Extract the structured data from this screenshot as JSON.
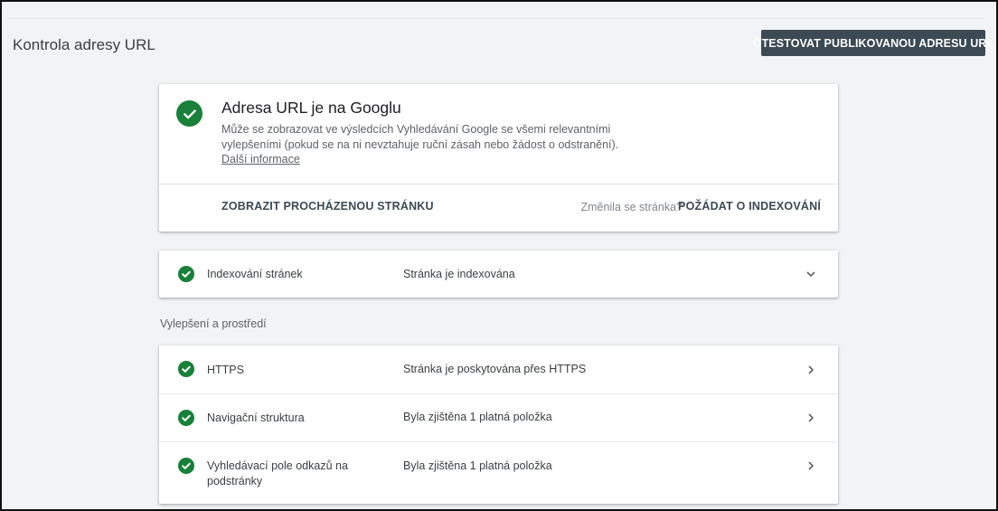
{
  "header": {
    "title": "Kontrola adresy URL",
    "test_live_label": "OTESTOVAT PUBLIKOVANOU ADRESU URL"
  },
  "status": {
    "heading": "Adresa URL je na Googlu",
    "description": "Může se zobrazovat ve výsledcích Vyhledávání Google se všemi relevantními vylepšeními (pokud se na ni nevztahuje ruční zásah nebo žádost o odstranění).",
    "learn_more": "Další informace",
    "view_crawled": "ZOBRAZIT PROCHÁZENOU STRÁNKU",
    "page_changed": "Změnila se stránka?",
    "request_indexing": "POŽÁDAT O INDEXOVÁNÍ"
  },
  "indexing": {
    "label": "Indexování stránek",
    "value": "Stránka je indexována"
  },
  "enhancements": {
    "section_label": "Vylepšení a prostředí",
    "items": [
      {
        "label": "HTTPS",
        "value": "Stránka je poskytována přes HTTPS"
      },
      {
        "label": "Navigační struktura",
        "value": "Byla zjištěna 1 platná položka"
      },
      {
        "label": "Vyhledávací pole odkazů na podstránky",
        "value": "Byla zjištěna 1 platná položka"
      }
    ]
  },
  "colors": {
    "success": "#188038",
    "primary_button": "#3c4a55",
    "background": "#f1f3f4"
  },
  "icons": {
    "status": "check-circle-icon",
    "expand": "chevron-down-icon",
    "navigate": "chevron-right-icon"
  }
}
